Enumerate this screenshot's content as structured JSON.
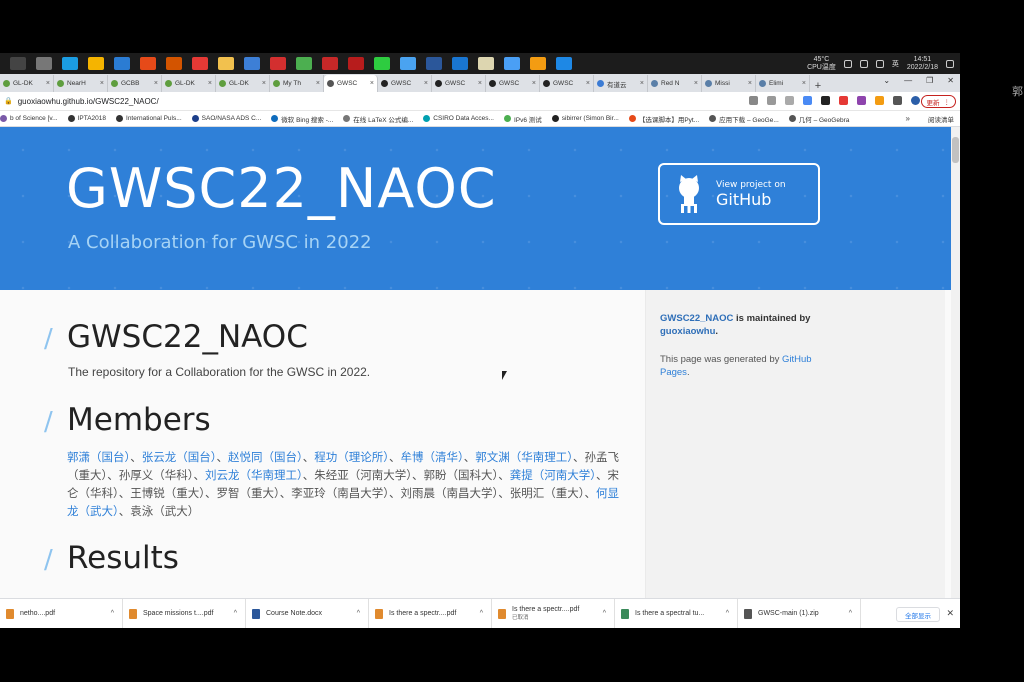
{
  "taskbar": {
    "apps": [
      {
        "name": "windows-icon",
        "color": "#444444"
      },
      {
        "name": "task-view-icon",
        "color": "#777777"
      },
      {
        "name": "edge-icon",
        "color": "#1b9de2"
      },
      {
        "name": "store-icon",
        "color": "#f5b400"
      },
      {
        "name": "mail-icon",
        "color": "#2b7cd3"
      },
      {
        "name": "office-icon",
        "color": "#e64a19"
      },
      {
        "name": "matlab-icon",
        "color": "#d35400"
      },
      {
        "name": "settings-app-icon",
        "color": "#e53935"
      },
      {
        "name": "folder-icon",
        "color": "#f2c14e"
      },
      {
        "name": "monitor-icon",
        "color": "#3d7fd6"
      },
      {
        "name": "app-red-icon",
        "color": "#d32f2f"
      },
      {
        "name": "chrome-icon",
        "color": "#4caf50"
      },
      {
        "name": "app-calendar-icon",
        "color": "#c62828"
      },
      {
        "name": "acrobat-icon",
        "color": "#b71c1c"
      },
      {
        "name": "wechat-icon",
        "color": "#2ecc40"
      },
      {
        "name": "feather-icon",
        "color": "#4aa3f0"
      },
      {
        "name": "word-icon",
        "color": "#2b579a"
      },
      {
        "name": "app-blue-icon",
        "color": "#1976d2"
      },
      {
        "name": "app-globe-icon",
        "color": "#ddd6b0"
      },
      {
        "name": "baidu-netdisk-icon",
        "color": "#4a9ff5"
      },
      {
        "name": "app-orange-icon",
        "color": "#f39c12"
      },
      {
        "name": "app-mountain-icon",
        "color": "#1e88e5"
      }
    ],
    "tray": {
      "temperature": "45°C",
      "cpu_label": "CPU温度",
      "ime": "英",
      "time": "14:51",
      "date": "2022/2/18"
    }
  },
  "side_name": "郭",
  "tabs": [
    {
      "label": "GL-DK",
      "color": "#5f9e3f"
    },
    {
      "label": "NearH",
      "color": "#5f9e3f"
    },
    {
      "label": "GCBB",
      "color": "#5f9e3f"
    },
    {
      "label": "GL-DK",
      "color": "#5f9e3f"
    },
    {
      "label": "GL-DK",
      "color": "#5f9e3f"
    },
    {
      "label": "My Th",
      "color": "#5f9e3f"
    },
    {
      "label": "GWSC",
      "color": "#555555",
      "active": true
    },
    {
      "label": "GWSC",
      "color": "#222222"
    },
    {
      "label": "GWSC",
      "color": "#222222"
    },
    {
      "label": "GWSC",
      "color": "#222222"
    },
    {
      "label": "GWSC",
      "color": "#222222"
    },
    {
      "label": "有道云",
      "color": "#3b7bd4"
    },
    {
      "label": "Red N",
      "color": "#5a7fa8"
    },
    {
      "label": "Missi",
      "color": "#5a7fa8"
    },
    {
      "label": "Elimi",
      "color": "#5a7fa8"
    }
  ],
  "address": {
    "url": "guoxiaowhu.github.io/GWSC22_NAOC/",
    "update_label": "更新"
  },
  "bookmarks": [
    {
      "label": "b of Science [v...",
      "color": "#7a5aa8"
    },
    {
      "label": "IPTA2018",
      "color": "#333333"
    },
    {
      "label": "International Puls...",
      "color": "#333333"
    },
    {
      "label": "SAO/NASA ADS C...",
      "color": "#1d3f8a"
    },
    {
      "label": "微软 Bing 搜索 -...",
      "color": "#0f6cbd"
    },
    {
      "label": "在线 LaTeX 公式编...",
      "color": "#777777"
    },
    {
      "label": "CSIRO Data Acces...",
      "color": "#00a0b0"
    },
    {
      "label": "IPv6 测试",
      "color": "#4caf50"
    },
    {
      "label": "sibirrer (Simon Bir...",
      "color": "#222222"
    },
    {
      "label": "【选课脚本】用Pyt...",
      "color": "#e64a19"
    },
    {
      "label": "应用下载 – GeoGe...",
      "color": "#555555"
    },
    {
      "label": "几何 – GeoGebra",
      "color": "#555555"
    }
  ],
  "bookmarks_more": "»",
  "reading_list": "阅读清单",
  "hero": {
    "title": "GWSC22_NAOC",
    "subtitle": "A Collaboration for GWSC in 2022",
    "github_small": "View project on",
    "github_big": "GitHub"
  },
  "content": {
    "section1_title": "GWSC22_NAOC",
    "section1_desc": "The repository for a Collaboration for the GWSC in 2022.",
    "section2_title": "Members",
    "section3_title": "Results",
    "slash": "/",
    "members": [
      {
        "text": "郭潇（国台）",
        "link": true
      },
      {
        "text": "、",
        "link": false
      },
      {
        "text": "张云龙（国台）",
        "link": true
      },
      {
        "text": "、",
        "link": false
      },
      {
        "text": "赵悦同（国台）",
        "link": true
      },
      {
        "text": "、",
        "link": false
      },
      {
        "text": "程功（理论所）",
        "link": true
      },
      {
        "text": "、",
        "link": false
      },
      {
        "text": "牟博（清华）",
        "link": true
      },
      {
        "text": "、",
        "link": false
      },
      {
        "text": "郭文渊（华南理工）",
        "link": true
      },
      {
        "text": "、孙孟飞（重大）、孙厚义（华科）、",
        "link": false
      },
      {
        "text": "刘云龙（华南理工）",
        "link": true
      },
      {
        "text": "、朱经亚（河南大学）、郭盼（国科大）、",
        "link": false
      },
      {
        "text": "龚提（河南大学）",
        "link": true
      },
      {
        "text": "、宋仑（华科）、王博锐（重大）、罗智（重大）、李亚玲（南昌大学）、刘雨晨（南昌大学）、张明汇（重大）、",
        "link": false
      },
      {
        "text": "何显龙（武大）",
        "link": true
      },
      {
        "text": "、袁泳（武大）",
        "link": false
      }
    ]
  },
  "sidebar": {
    "repo": "GWSC22_NAOC",
    "maintained_text": " is maintained by ",
    "owner": "guoxiaowhu",
    "period": ".",
    "generated_text": "This page was generated by ",
    "pages_link": "GitHub Pages",
    "generated_end": "."
  },
  "downloads": [
    {
      "label": "netho....pdf",
      "color": "#e08a2e"
    },
    {
      "label": "Space missions t....pdf",
      "color": "#e08a2e"
    },
    {
      "label": "Course Note.docx",
      "color": "#2b579a"
    },
    {
      "label": "Is there a spectr....pdf",
      "color": "#e08a2e"
    },
    {
      "label": "Is there a spectr....pdf",
      "color": "#e08a2e",
      "status": "已取消"
    },
    {
      "label": "Is there a spectral tu...",
      "color": "#3a8a5a"
    },
    {
      "label": "GWSC-main (1).zip",
      "color": "#555555"
    }
  ],
  "downloads_all": "全部显示",
  "colors": {
    "hero_bg": "#2f80d8",
    "link": "#2f80d8"
  }
}
